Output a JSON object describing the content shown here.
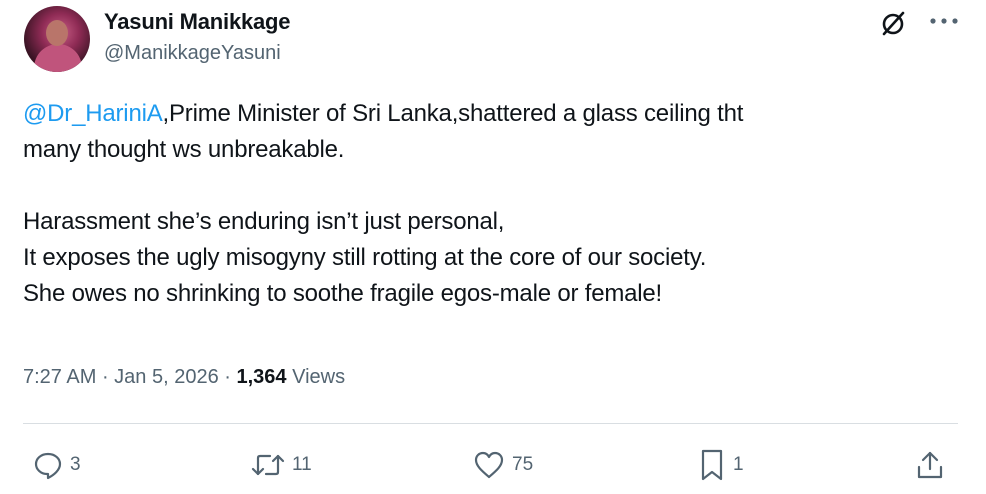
{
  "author": {
    "name": "Yasuni Manikkage",
    "handle": "@ManikkageYasuni"
  },
  "post": {
    "mention": "@Dr_HariniA",
    "line1_rest": ",Prime Minister of Sri Lanka,shattered a glass ceiling tht",
    "line2": "many thought ws unbreakable.",
    "line3": "Harassment she’s enduring isn’t just personal,",
    "line4": "It exposes the ugly misogyny still rotting at the core of our society.",
    "line5": "She owes no shrinking to soothe fragile egos-male or female!"
  },
  "meta": {
    "time": "7:27 AM",
    "separator1": " · ",
    "date": "Jan 5, 2026",
    "separator2": " · ",
    "views_count": "1,364",
    "views_label": " Views"
  },
  "actions": {
    "replies": "3",
    "reposts": "11",
    "likes": "75",
    "bookmarks": "1"
  },
  "icons": {
    "header": [
      "grok-icon",
      "more-icon"
    ],
    "actions": [
      "reply-icon",
      "retweet-icon",
      "like-icon",
      "bookmark-icon",
      "share-icon"
    ]
  },
  "colors": {
    "text": "#0f1419",
    "secondary": "#536471",
    "link": "#1d9bf0",
    "divider": "#d9dee2"
  }
}
